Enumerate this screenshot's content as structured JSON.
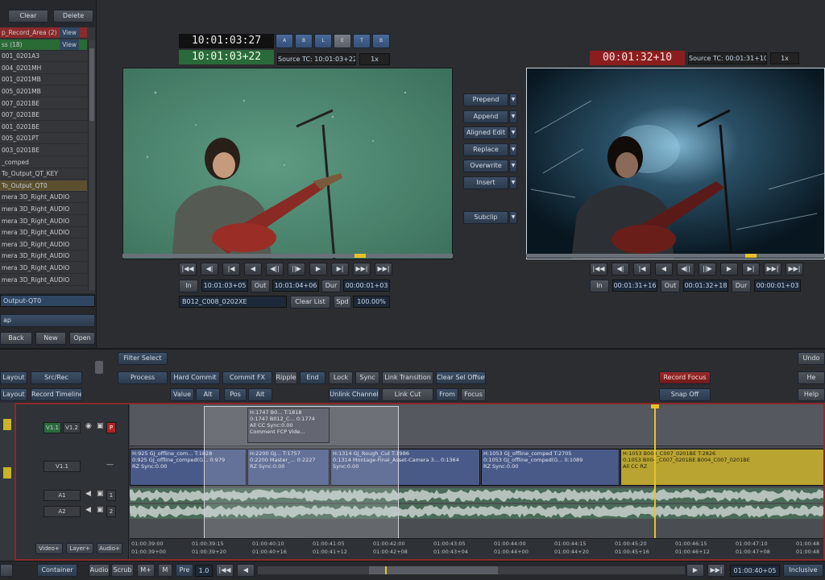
{
  "bin_panel": {
    "top_buttons": [
      "Clear",
      "Delete"
    ],
    "view_label": "View",
    "items": [
      {
        "label": "p_Record_Area (2)",
        "view": "View",
        "color": "#8a2a2a"
      },
      {
        "label": "ss (18)",
        "view": "View",
        "color": "#2a6a34"
      },
      {
        "label": "001_0201A3",
        "color": ""
      },
      {
        "label": "004_0201MH",
        "color": ""
      },
      {
        "label": "001_0201MB",
        "color": ""
      },
      {
        "label": "005_0201MB",
        "color": ""
      },
      {
        "label": "007_0201BE",
        "color": ""
      },
      {
        "label": "007_0201BE",
        "color": ""
      },
      {
        "label": "001_0201BE",
        "color": ""
      },
      {
        "label": "005_0201PT",
        "color": ""
      },
      {
        "label": "003_0201BE",
        "color": ""
      },
      {
        "label": "_comped",
        "color": ""
      },
      {
        "label": "To_Output_QT_KEY",
        "color": ""
      },
      {
        "label": "To_Output_QT0",
        "color": "#5a5030"
      },
      {
        "label": "mera 3D_Right_AUDIO",
        "color": ""
      },
      {
        "label": "mera 3D_Right_AUDIO",
        "color": ""
      },
      {
        "label": "mera 3D_Right_AUDIO",
        "color": ""
      },
      {
        "label": "mera 3D_Right_AUDIO",
        "color": ""
      },
      {
        "label": "mera 3D_Right_AUDIO",
        "color": ""
      },
      {
        "label": "mera 3D_Right_AUDIO",
        "color": ""
      },
      {
        "label": "mera 3D_Right_AUDIO",
        "color": ""
      },
      {
        "label": "mera 3D_Right_AUDIO",
        "color": ""
      }
    ],
    "output_field": "Output-QT0",
    "section_label": "ap",
    "bottom_buttons": [
      "Back",
      "New",
      "Open"
    ]
  },
  "source_viewer": {
    "timecode_top": "10:01:03:27",
    "timecode_main": "10:01:03+22",
    "source_tc": "Source TC: 10:01:03+22",
    "speed": "1x",
    "mode_buttons": [
      "A",
      "B",
      "L",
      "E",
      "T",
      "B"
    ],
    "in_label": "In",
    "in_value": "10:01:03+05",
    "out_label": "Out",
    "out_value": "10:01:04+06",
    "dur_label": "Dur",
    "dur_value": "00:00:01+03",
    "clip_name": "B012_C008_0202XE",
    "clear_list": "Clear List",
    "spd_label": "Spd",
    "spd_value": "100.00%"
  },
  "edit_buttons": [
    "Prepend",
    "Append",
    "Aligned Edit",
    "Replace",
    "Overwrite",
    "Insert",
    "Subclip"
  ],
  "record_viewer": {
    "timecode_main": "00:01:32+10",
    "source_tc": "Source TC: 00:01:31+10",
    "speed": "1x",
    "in_label": "In",
    "in_value": "00:01:31+16",
    "out_label": "Out",
    "out_value": "00:01:32+18",
    "dur_label": "Dur",
    "dur_value": "00:00:01+03"
  },
  "transport_icons": [
    "|◀◀",
    "◀|",
    "|◀",
    "◀",
    "◀||",
    "||▶",
    "▶",
    "▶|",
    "▶▶|",
    "▶▶|"
  ],
  "toolbar": {
    "filter_select": "Filter Select",
    "layout": "Layout",
    "src_rec": "Src/Rec",
    "layout2": "Layout",
    "record_timeline": "Record Timeline",
    "process": "Process",
    "hard_commit": "Hard Commit",
    "commit_fx": "Commit FX",
    "ripple": "Ripple",
    "end": "End",
    "lock": "Lock",
    "sync": "Sync",
    "link_transition": "Link Transition",
    "clear_sel_offset": "Clear Sel Offset",
    "value": "Value",
    "alt1": "Alt",
    "pos": "Pos",
    "alt2": "Alt",
    "unlink_channel": "Unlink Channel",
    "link_cut": "Link Cut",
    "from": "From",
    "focus": "Focus",
    "record_focus": "Record Focus",
    "snap_off": "Snap Off",
    "right_buttons": [
      "Undo",
      "He",
      "Help"
    ]
  },
  "timeline": {
    "tracks": [
      {
        "name": "V1.1",
        "label2": "V1.2",
        "patch": "P"
      },
      {
        "name": "V1.1",
        "label2": ""
      },
      {
        "name": "A1",
        "label2": "1"
      },
      {
        "name": "A2",
        "label2": "2"
      }
    ],
    "top_clip": {
      "line1": "H:1747  B0...  T:1818",
      "line2": "0:1747  B012_C...  0:1774",
      "line3": "All CC         Sync:0.00",
      "line4": "Comment       FCP Vide..."
    },
    "clips": [
      {
        "line1": "H:925   GJ_offline_com...   T:1828",
        "line2": "0:925  GJ_offline_comped(G...  0:979",
        "line3": "RZ                         Sync:0.00"
      },
      {
        "line1": "H:2200  GJ...   T:1757",
        "line2": "0:2200  Master_...  0:2227",
        "line3": "RZ                      Sync:0.00"
      },
      {
        "line1": "H:1314        GJ_Rough_Cut   T:1986",
        "line2": "0:1314  Montage-Final_Asset-Camera 3...  0:1364",
        "line3": "                         Sync:0.00"
      },
      {
        "line1": "H:1053   GJ_offline_comped   T:2705",
        "line2": "0:1053  GJ_offline_comped(G...  0:1089",
        "line3": "RZ                    Sync:0.00"
      },
      {
        "line1": "H:1053        B004_C007_0201BE   T:2826",
        "line2": "0:1053  B004_C007_0201BE  B004_C007_0201BE",
        "line3": "All CC RZ"
      }
    ],
    "ruler_top": [
      "01:00:39:00",
      "01:00:39:15",
      "01:00:40:10",
      "01:00:41:05",
      "01:00:42:00",
      "01:00:43:05",
      "01:00:44:00",
      "01:00:44:15",
      "01:00:45:20",
      "01:00:46:15",
      "01:00:47:10",
      "01:00:48"
    ],
    "ruler_bottom": [
      "01:00:39+00",
      "01:00:39+20",
      "01:00:40+16",
      "01:00:41+12",
      "01:00:42+08",
      "01:00:43+04",
      "01:00:44+00",
      "01:00:44+20",
      "01:00:45+16",
      "01:00:46+12",
      "01:00:47+08",
      "01:00:48"
    ],
    "bottom_ctl": [
      "Video+",
      "Layer+",
      "Audio+"
    ]
  },
  "status_bar": {
    "container": "Container",
    "audio": "Audio",
    "scrub": "Scrub",
    "m_plus": "M+",
    "m": "M",
    "pre": "Pre",
    "zoom": "1.0",
    "timecode": "01:00:40+05",
    "inclusive": "Inclusive"
  },
  "colors": {
    "accent_blue": "#2f4662",
    "timeline_border": "#8a2a2a",
    "clip_blue": "#4a5a88",
    "clip_yellow": "#b9a432",
    "playhead": "#e6c228"
  }
}
